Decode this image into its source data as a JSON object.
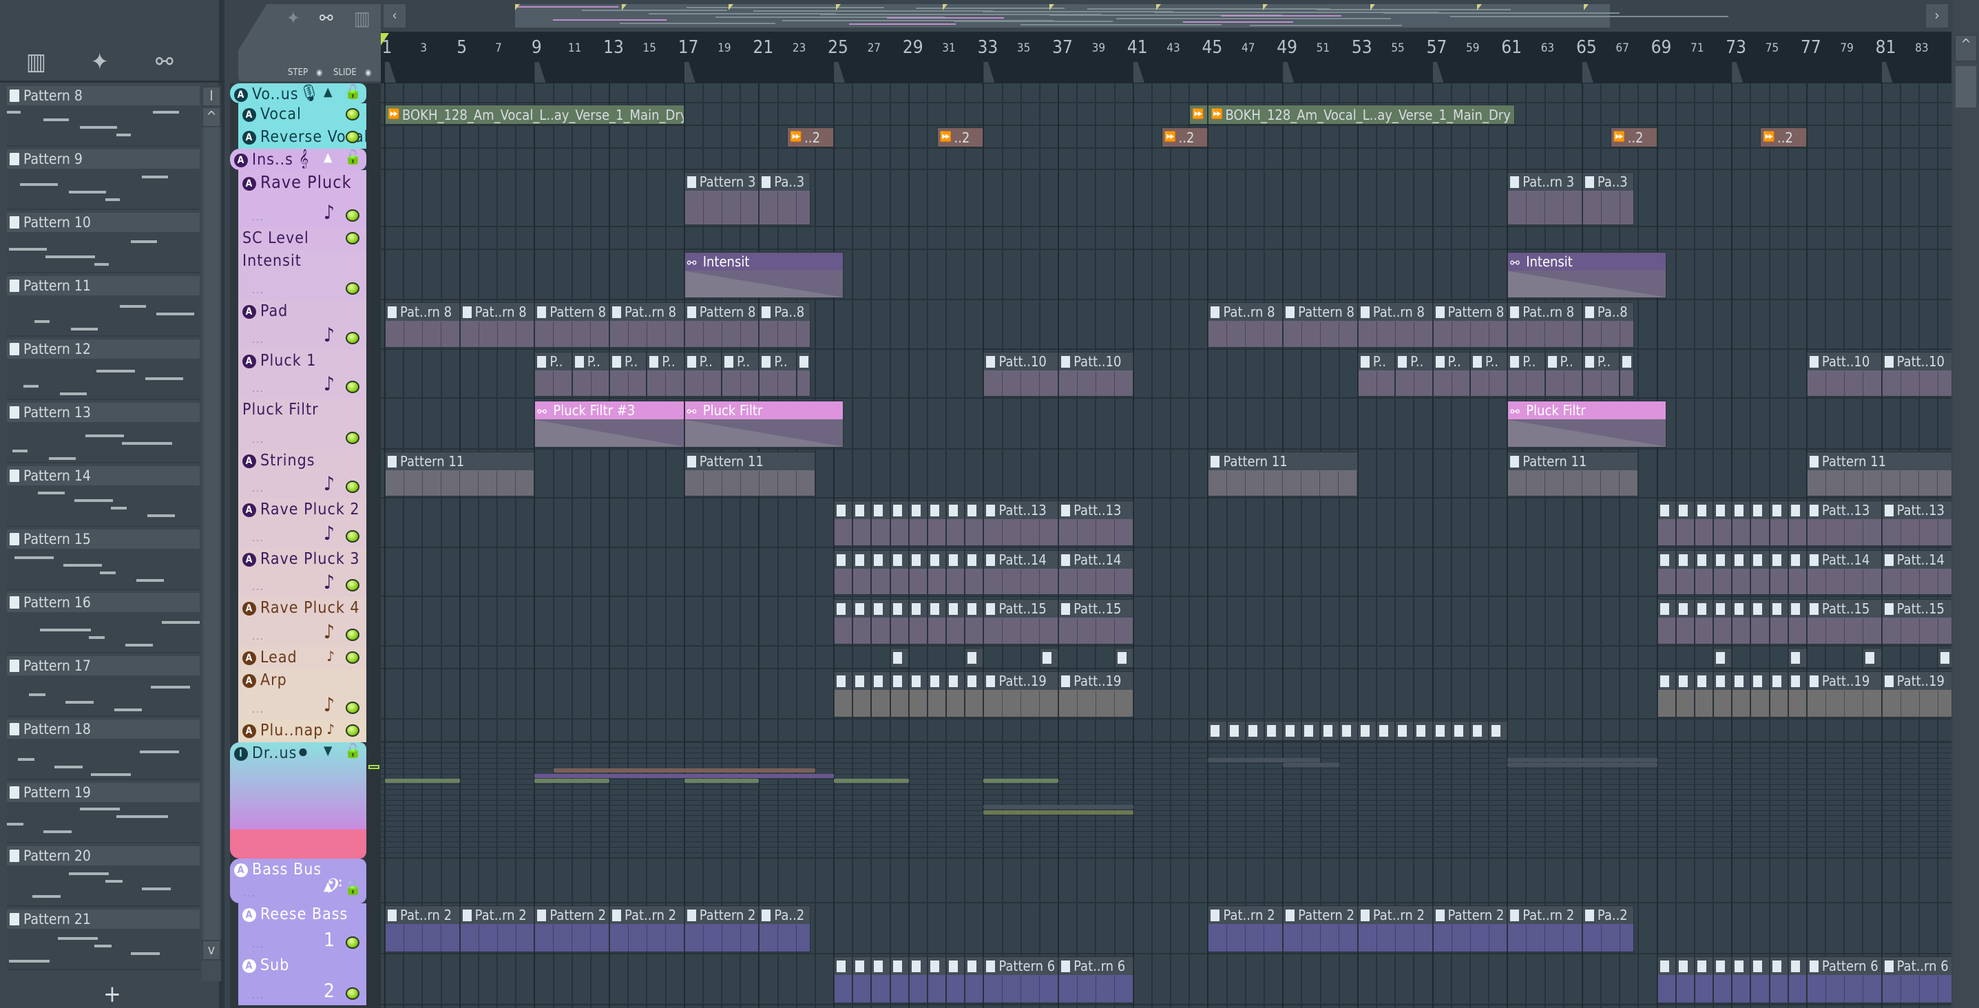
{
  "left_panel": {
    "tools": [
      {
        "name": "piano-roll-icon",
        "glyph": "▥"
      },
      {
        "name": "audio-wave-icon",
        "glyph": "✦"
      },
      {
        "name": "automation-icon",
        "glyph": "⚯"
      }
    ],
    "patterns": [
      "Pattern 8",
      "Pattern 9",
      "Pattern 10",
      "Pattern 11",
      "Pattern 12",
      "Pattern 13",
      "Pattern 14",
      "Pattern 15",
      "Pattern 16",
      "Pattern 17",
      "Pattern 18",
      "Pattern 19",
      "Pattern 20",
      "Pattern 21"
    ],
    "add_label": "+",
    "scroll_up": "^",
    "scroll_down": "v",
    "scroll_top": "I"
  },
  "header": {
    "step_label": "STEP",
    "slide_label": "SLIDE"
  },
  "overview": {
    "left_arrow": "‹",
    "right_arrow": "›"
  },
  "ruler": {
    "bars": [
      1,
      3,
      5,
      7,
      9,
      11,
      13,
      15,
      17,
      19,
      21,
      23,
      25,
      27,
      29,
      31,
      33,
      35,
      37,
      39,
      41,
      43,
      45,
      47,
      49,
      51,
      53,
      55,
      57,
      59,
      61,
      63,
      65,
      67,
      69,
      71,
      73,
      75,
      77,
      79,
      81,
      83
    ]
  },
  "colors": {
    "vocal_group": "#7fdfe2",
    "inst_group": "#d3b2e8",
    "inst_group_end": "#e8d8c6",
    "drum_top": "#8ddfe0",
    "drum_bottom": "#f07398",
    "bass_group": "#ad9fea",
    "pattern_head": "#434e58",
    "pattern_body": "#6b6479",
    "auto_pink": "#dd94dc",
    "auto_dark": "#6a5a8c",
    "audio": "#61795f",
    "reverse": "#7c6160",
    "bass_body": "#5a5990"
  },
  "tracks": [
    {
      "name": "Vo..us",
      "type": "group",
      "icon": "mic",
      "badge": "A",
      "collapse": "▲"
    },
    {
      "name": "Vocal",
      "badge": "A"
    },
    {
      "name": "Reverse Vocal",
      "badge": "A"
    },
    {
      "name": "Ins..s",
      "type": "group",
      "icon": "𝄞",
      "badge": "A",
      "collapse": "▲"
    },
    {
      "name": "Rave Pluck",
      "badge": "A",
      "note": "♪"
    },
    {
      "name": "SC Level"
    },
    {
      "name": "Intensit"
    },
    {
      "name": "Pad",
      "badge": "A",
      "note": "♪"
    },
    {
      "name": "Pluck 1",
      "badge": "A",
      "note": "♪"
    },
    {
      "name": "Pluck Filtr"
    },
    {
      "name": "Strings",
      "badge": "A",
      "note": "♪"
    },
    {
      "name": "Rave Pluck 2",
      "badge": "A",
      "note": "♪"
    },
    {
      "name": "Rave Pluck 3",
      "badge": "A",
      "note": "♪"
    },
    {
      "name": "Rave Pluck 4",
      "badge": "A",
      "note": "♪"
    },
    {
      "name": "Lead",
      "badge": "A",
      "note": "♪"
    },
    {
      "name": "Arp",
      "badge": "A",
      "note": "♪"
    },
    {
      "name": "Plu..nap",
      "badge": "A",
      "note": "♪"
    },
    {
      "name": "Dr..us",
      "type": "group",
      "icon": "drum",
      "badge": "I",
      "collapse": "▼"
    },
    {
      "name": "Bass Bus",
      "type": "group",
      "icon": "𝄢",
      "badge": "A",
      "collapse": "▲"
    },
    {
      "name": "Reese Bass",
      "badge": "A",
      "note": "1"
    },
    {
      "name": "Sub",
      "badge": "A",
      "note": "2"
    }
  ],
  "clips": [
    {
      "t": 1,
      "s": 1,
      "l": 16,
      "n": "BOKH_128_Am_Vocal_L..ay_Verse_1_Main_Dry",
      "k": "audio"
    },
    {
      "t": 1,
      "s": 44,
      "l": 1,
      "n": "",
      "k": "audio"
    },
    {
      "t": 1,
      "s": 45,
      "l": 16.4,
      "n": "BOKH_128_Am_Vocal_L..ay_Verse_1_Main_Dry",
      "k": "audio"
    },
    {
      "t": 2,
      "s": 22.5,
      "l": 2.5,
      "n": "..2",
      "k": "rev"
    },
    {
      "t": 2,
      "s": 30.5,
      "l": 2.5,
      "n": "..2",
      "k": "rev"
    },
    {
      "t": 2,
      "s": 42.5,
      "l": 2.5,
      "n": "..2",
      "k": "rev"
    },
    {
      "t": 2,
      "s": 66.5,
      "l": 2.5,
      "n": "..2",
      "k": "rev"
    },
    {
      "t": 2,
      "s": 74.5,
      "l": 2.5,
      "n": "..2",
      "k": "rev"
    },
    {
      "t": 4,
      "s": 17,
      "l": 4,
      "n": "Pattern 3",
      "k": "pat"
    },
    {
      "t": 4,
      "s": 21,
      "l": 2.75,
      "n": "Pa..3",
      "k": "pat"
    },
    {
      "t": 4,
      "s": 61,
      "l": 4,
      "n": "Pat..rn 3",
      "k": "pat"
    },
    {
      "t": 4,
      "s": 65,
      "l": 2.75,
      "n": "Pa..3",
      "k": "pat"
    },
    {
      "t": 6,
      "s": 17,
      "l": 8.5,
      "n": "Intensit",
      "k": "autodark"
    },
    {
      "t": 6,
      "s": 61,
      "l": 8.5,
      "n": "Intensit",
      "k": "autodark"
    },
    {
      "t": 7,
      "s": 1,
      "l": 4,
      "n": "Pat..rn 8",
      "k": "pat"
    },
    {
      "t": 7,
      "s": 5,
      "l": 4,
      "n": "Pat..rn 8",
      "k": "pat"
    },
    {
      "t": 7,
      "s": 9,
      "l": 4,
      "n": "Pattern 8",
      "k": "pat"
    },
    {
      "t": 7,
      "s": 13,
      "l": 4,
      "n": "Pat..rn 8",
      "k": "pat"
    },
    {
      "t": 7,
      "s": 17,
      "l": 4,
      "n": "Pattern 8",
      "k": "pat"
    },
    {
      "t": 7,
      "s": 21,
      "l": 2.75,
      "n": "Pa..8",
      "k": "pat"
    },
    {
      "t": 7,
      "s": 45,
      "l": 4,
      "n": "Pat..rn 8",
      "k": "pat"
    },
    {
      "t": 7,
      "s": 49,
      "l": 4,
      "n": "Pattern 8",
      "k": "pat"
    },
    {
      "t": 7,
      "s": 53,
      "l": 4,
      "n": "Pat..rn 8",
      "k": "pat"
    },
    {
      "t": 7,
      "s": 57,
      "l": 4,
      "n": "Pattern 8",
      "k": "pat"
    },
    {
      "t": 7,
      "s": 61,
      "l": 4,
      "n": "Pat..rn 8",
      "k": "pat"
    },
    {
      "t": 7,
      "s": 65,
      "l": 2.75,
      "n": "Pa..8",
      "k": "pat"
    },
    {
      "t": 8,
      "s": 9,
      "l": 2,
      "n": "P..",
      "k": "pat"
    },
    {
      "t": 8,
      "s": 11,
      "l": 2,
      "n": "P..",
      "k": "pat"
    },
    {
      "t": 8,
      "s": 13,
      "l": 2,
      "n": "P..",
      "k": "pat"
    },
    {
      "t": 8,
      "s": 15,
      "l": 2,
      "n": "P..",
      "k": "pat"
    },
    {
      "t": 8,
      "s": 17,
      "l": 2,
      "n": "P..",
      "k": "pat"
    },
    {
      "t": 8,
      "s": 19,
      "l": 2,
      "n": "P..",
      "k": "pat"
    },
    {
      "t": 8,
      "s": 21,
      "l": 2,
      "n": "P..",
      "k": "pat"
    },
    {
      "t": 8,
      "s": 23,
      "l": 0.75,
      "n": "",
      "k": "pat"
    },
    {
      "t": 8,
      "s": 33,
      "l": 4,
      "n": "Patt..10",
      "k": "pat"
    },
    {
      "t": 8,
      "s": 37,
      "l": 4,
      "n": "Patt..10",
      "k": "pat"
    },
    {
      "t": 8,
      "s": 53,
      "l": 2,
      "n": "P..",
      "k": "pat"
    },
    {
      "t": 8,
      "s": 55,
      "l": 2,
      "n": "P..",
      "k": "pat"
    },
    {
      "t": 8,
      "s": 57,
      "l": 2,
      "n": "P..",
      "k": "pat"
    },
    {
      "t": 8,
      "s": 59,
      "l": 2,
      "n": "P..",
      "k": "pat"
    },
    {
      "t": 8,
      "s": 61,
      "l": 2,
      "n": "P..",
      "k": "pat"
    },
    {
      "t": 8,
      "s": 63,
      "l": 2,
      "n": "P..",
      "k": "pat"
    },
    {
      "t": 8,
      "s": 65,
      "l": 2,
      "n": "P..",
      "k": "pat"
    },
    {
      "t": 8,
      "s": 67,
      "l": 0.75,
      "n": "",
      "k": "pat"
    },
    {
      "t": 8,
      "s": 77,
      "l": 4,
      "n": "Patt..10",
      "k": "pat"
    },
    {
      "t": 8,
      "s": 81,
      "l": 4,
      "n": "Patt..10",
      "k": "pat"
    },
    {
      "t": 9,
      "s": 9,
      "l": 8,
      "n": "Pluck Filtr #3",
      "k": "auto"
    },
    {
      "t": 9,
      "s": 17,
      "l": 8.5,
      "n": "Pluck Filtr",
      "k": "auto"
    },
    {
      "t": 9,
      "s": 61,
      "l": 8.5,
      "n": "Pluck Filtr",
      "k": "auto"
    },
    {
      "t": 10,
      "s": 1,
      "l": 8,
      "n": "Pattern 11",
      "k": "pat"
    },
    {
      "t": 10,
      "s": 17,
      "l": 7,
      "n": "Pattern 11",
      "k": "pat"
    },
    {
      "t": 10,
      "s": 45,
      "l": 8,
      "n": "Pattern 11",
      "k": "pat"
    },
    {
      "t": 10,
      "s": 61,
      "l": 7,
      "n": "Pattern 11",
      "k": "pat"
    },
    {
      "t": 10,
      "s": 77,
      "l": 8,
      "n": "Pattern 11",
      "k": "pat"
    },
    {
      "t": 18,
      "s": 0,
      "l": 0,
      "n": "",
      "k": "none"
    }
  ],
  "repeat_groups": [
    {
      "t": 11,
      "label": "Patt..13"
    },
    {
      "t": 12,
      "label": "Patt..14"
    },
    {
      "t": 13,
      "label": "Patt..15"
    },
    {
      "t": 15,
      "label": "Patt..19"
    },
    {
      "t": 20,
      "label": "Pattern 6",
      "label2": "Pat..rn 6"
    }
  ],
  "lead_clips": [
    28,
    32,
    36,
    40,
    72,
    76,
    80,
    84
  ],
  "plunap_clips": [
    45,
    46,
    47,
    48,
    49,
    50,
    51,
    52,
    53,
    54,
    55,
    56,
    57,
    58,
    59,
    60
  ],
  "reese": [
    [
      "Pat..rn 2",
      1
    ],
    [
      "Pat..rn 2",
      5
    ],
    [
      "Pattern 2",
      9
    ],
    [
      "Pat..rn 2",
      13
    ],
    [
      "Pattern 2",
      17
    ],
    [
      "Pa..2",
      21
    ],
    [
      "Pat..rn 2",
      45
    ],
    [
      "Pattern 2",
      49
    ],
    [
      "Pat..rn 2",
      53
    ],
    [
      "Pattern 2",
      57
    ],
    [
      "Pat..rn 2",
      61
    ],
    [
      "Pa..2",
      65
    ]
  ],
  "drum_lanes": [
    {
      "lane": 3,
      "s": 45,
      "l": 6,
      "c": "#47525c"
    },
    {
      "lane": 3,
      "s": 61,
      "l": 8,
      "c": "#47525c"
    },
    {
      "lane": 4,
      "s": 49,
      "l": 3,
      "c": "#47525c"
    },
    {
      "lane": 4,
      "s": 61,
      "l": 8,
      "c": "#47525c"
    },
    {
      "lane": 5,
      "s": 10,
      "l": 14,
      "c": "#7a5f58"
    },
    {
      "lane": 6,
      "s": 9,
      "l": 16,
      "c": "#6a5790"
    },
    {
      "lane": 7,
      "s": 1,
      "l": 4,
      "c": "#6c8360"
    },
    {
      "lane": 7,
      "s": 9,
      "l": 4,
      "c": "#6c8360"
    },
    {
      "lane": 7,
      "s": 17,
      "l": 4,
      "c": "#6c8360"
    },
    {
      "lane": 7,
      "s": 25,
      "l": 4,
      "c": "#6c8360"
    },
    {
      "lane": 7,
      "s": 33,
      "l": 4,
      "c": "#6c8360"
    },
    {
      "lane": 12,
      "s": 33,
      "l": 8,
      "c": "#47525c"
    },
    {
      "lane": 13,
      "s": 33,
      "l": 8,
      "c": "#6c7a50"
    }
  ]
}
